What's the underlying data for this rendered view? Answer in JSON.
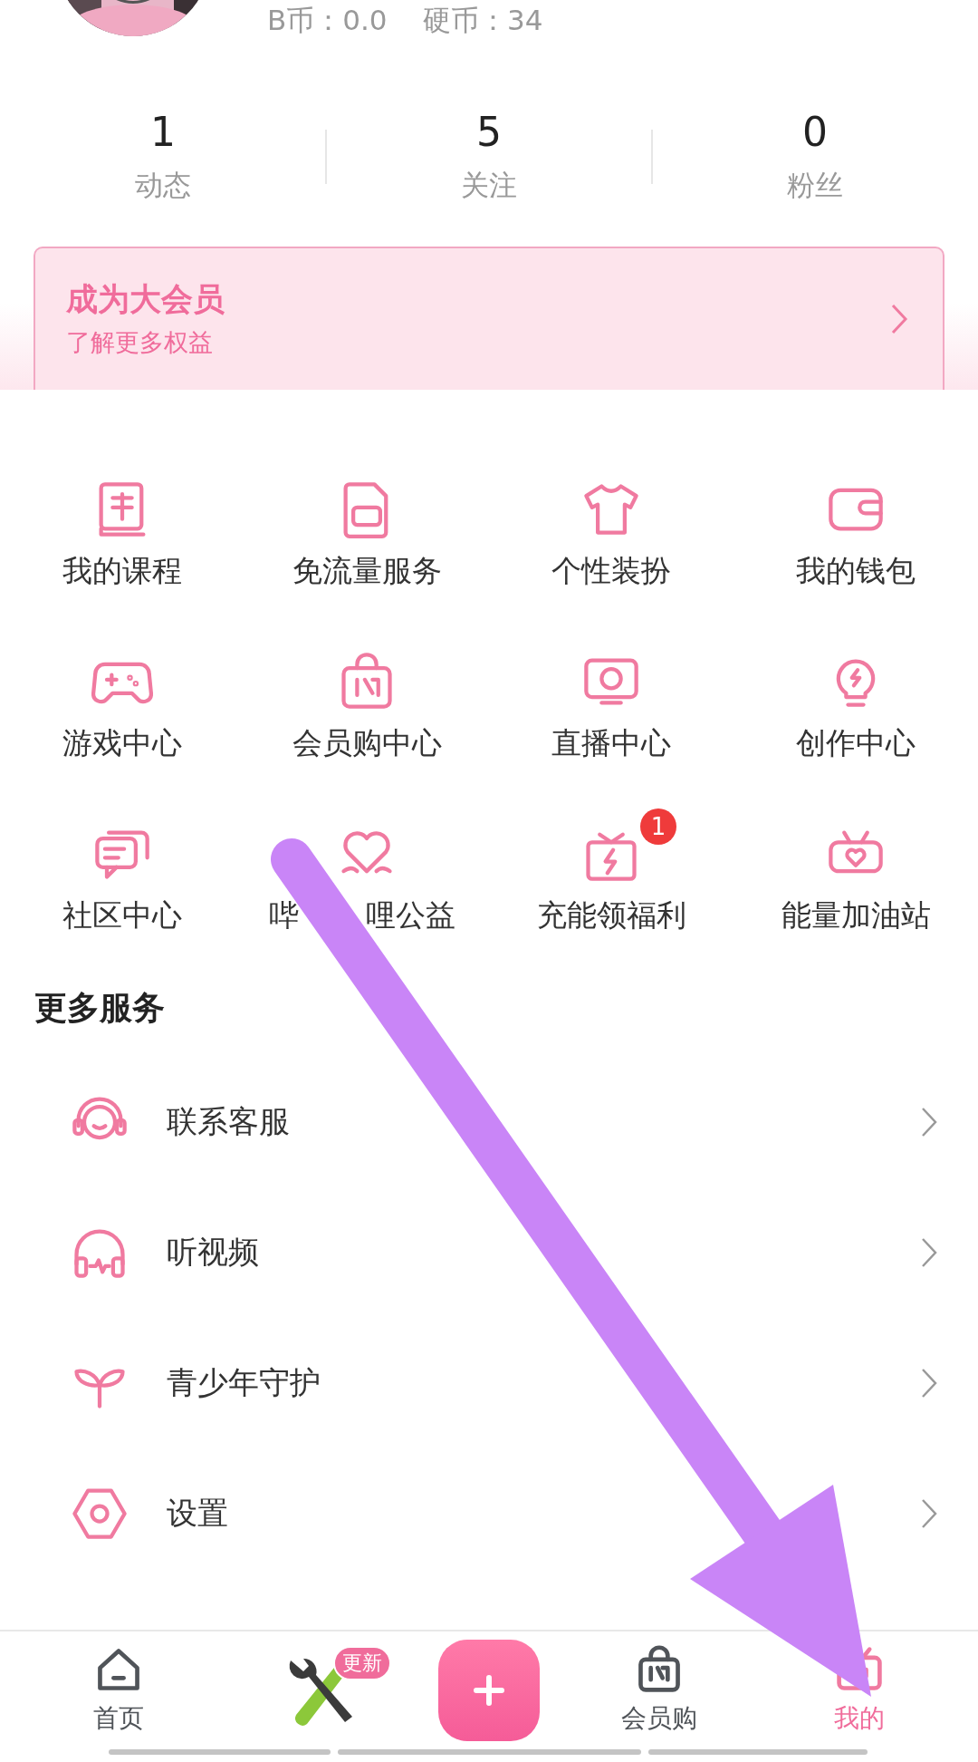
{
  "profile": {
    "coins": "B币：0.0    硬币：34"
  },
  "stats": [
    {
      "value": "1",
      "label": "动态"
    },
    {
      "value": "5",
      "label": "关注"
    },
    {
      "value": "0",
      "label": "粉丝"
    }
  ],
  "vip_banner": {
    "title": "成为大会员",
    "subtitle": "了解更多权益"
  },
  "services": [
    {
      "label": "我的课程"
    },
    {
      "label": "免流量服务"
    },
    {
      "label": "个性装扮"
    },
    {
      "label": "我的钱包"
    },
    {
      "label": "游戏中心"
    },
    {
      "label": "会员购中心"
    },
    {
      "label": "直播中心"
    },
    {
      "label": "创作中心"
    },
    {
      "label": "社区中心"
    },
    {
      "label": "哔",
      "label_tail": "哩公益"
    },
    {
      "label": "充能领福利",
      "badge": "1"
    },
    {
      "label": "能量加油站"
    }
  ],
  "more_services": {
    "title": "更多服务",
    "items": [
      {
        "label": "联系客服"
      },
      {
        "label": "听视频"
      },
      {
        "label": "青少年守护"
      },
      {
        "label": "设置"
      }
    ]
  },
  "tab_bar": [
    {
      "kind": "tab",
      "label": "首页",
      "selected": false
    },
    {
      "kind": "tool",
      "badge": "更新"
    },
    {
      "kind": "add"
    },
    {
      "kind": "tab",
      "label": "会员购",
      "selected": false
    },
    {
      "kind": "tab",
      "label": "我的",
      "selected": true
    }
  ]
}
